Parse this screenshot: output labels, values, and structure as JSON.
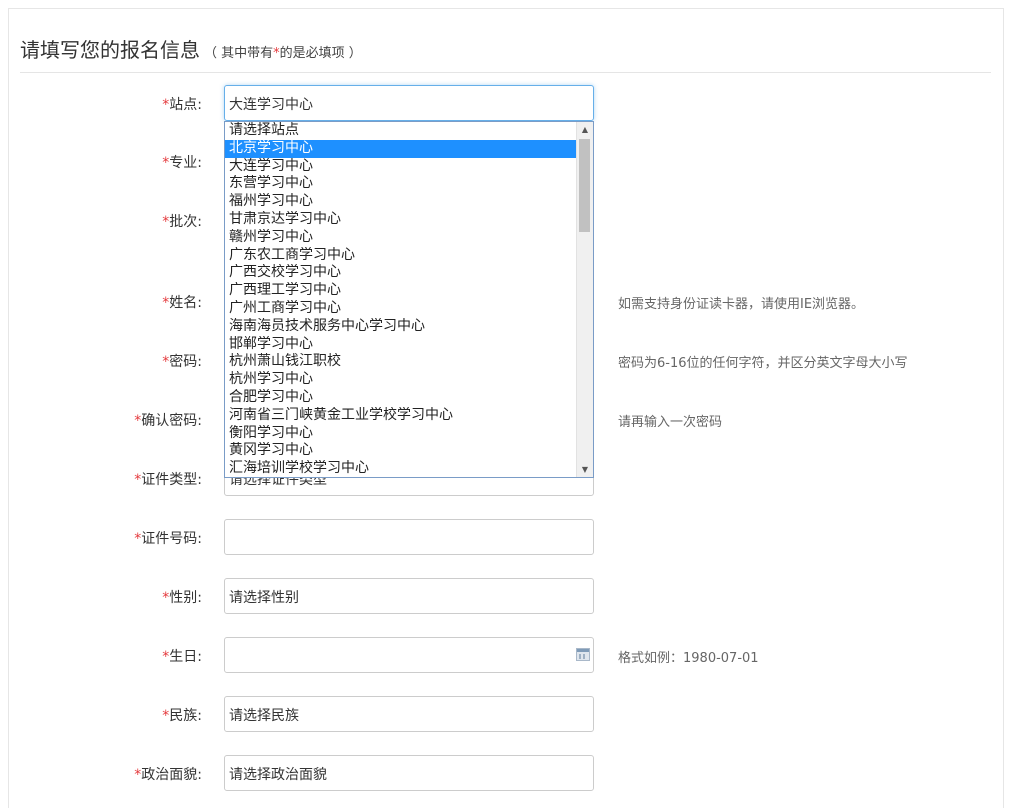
{
  "heading": {
    "title": "请填写您的报名信息",
    "note_open": "（ 其中带有",
    "star": "*",
    "note_close": "的是必填项 ）"
  },
  "form": {
    "required_mark": "*",
    "station": {
      "label": "站点:",
      "value": "大连学习中心"
    },
    "major": {
      "label": "专业:"
    },
    "batch": {
      "label": "批次:"
    },
    "name": {
      "label": "姓名:",
      "hint": "如需支持身份证读卡器，请使用IE浏览器。"
    },
    "password": {
      "label": "密码:",
      "hint": "密码为6-16位的任何字符，并区分英文字母大小写"
    },
    "confirm": {
      "label": "确认密码:",
      "hint": "请再输入一次密码"
    },
    "id_type": {
      "label": "证件类型:",
      "value": "请选择证件类型"
    },
    "id_number": {
      "label": "证件号码:",
      "value": ""
    },
    "gender": {
      "label": "性别:",
      "value": "请选择性别"
    },
    "birthday": {
      "label": "生日:",
      "value": "",
      "hint": "格式如例：1980-07-01"
    },
    "ethnicity": {
      "label": "民族:",
      "value": "请选择民族"
    },
    "politics": {
      "label": "政治面貌:",
      "value": "请选择政治面貌"
    }
  },
  "dropdown": {
    "selected_index": 1,
    "scroll_thumb_fraction": 0.27,
    "options": [
      "请选择站点",
      "北京学习中心",
      "大连学习中心",
      "东营学习中心",
      "福州学习中心",
      "甘肃京达学习中心",
      "赣州学习中心",
      "广东农工商学习中心",
      "广西交校学习中心",
      "广西理工学习中心",
      "广州工商学习中心",
      "海南海员技术服务中心学习中心",
      "邯郸学习中心",
      "杭州萧山钱江职校",
      "杭州学习中心",
      "合肥学习中心",
      "河南省三门峡黄金工业学校学习中心",
      "衡阳学习中心",
      "黄冈学习中心",
      "汇海培训学校学习中心"
    ]
  }
}
